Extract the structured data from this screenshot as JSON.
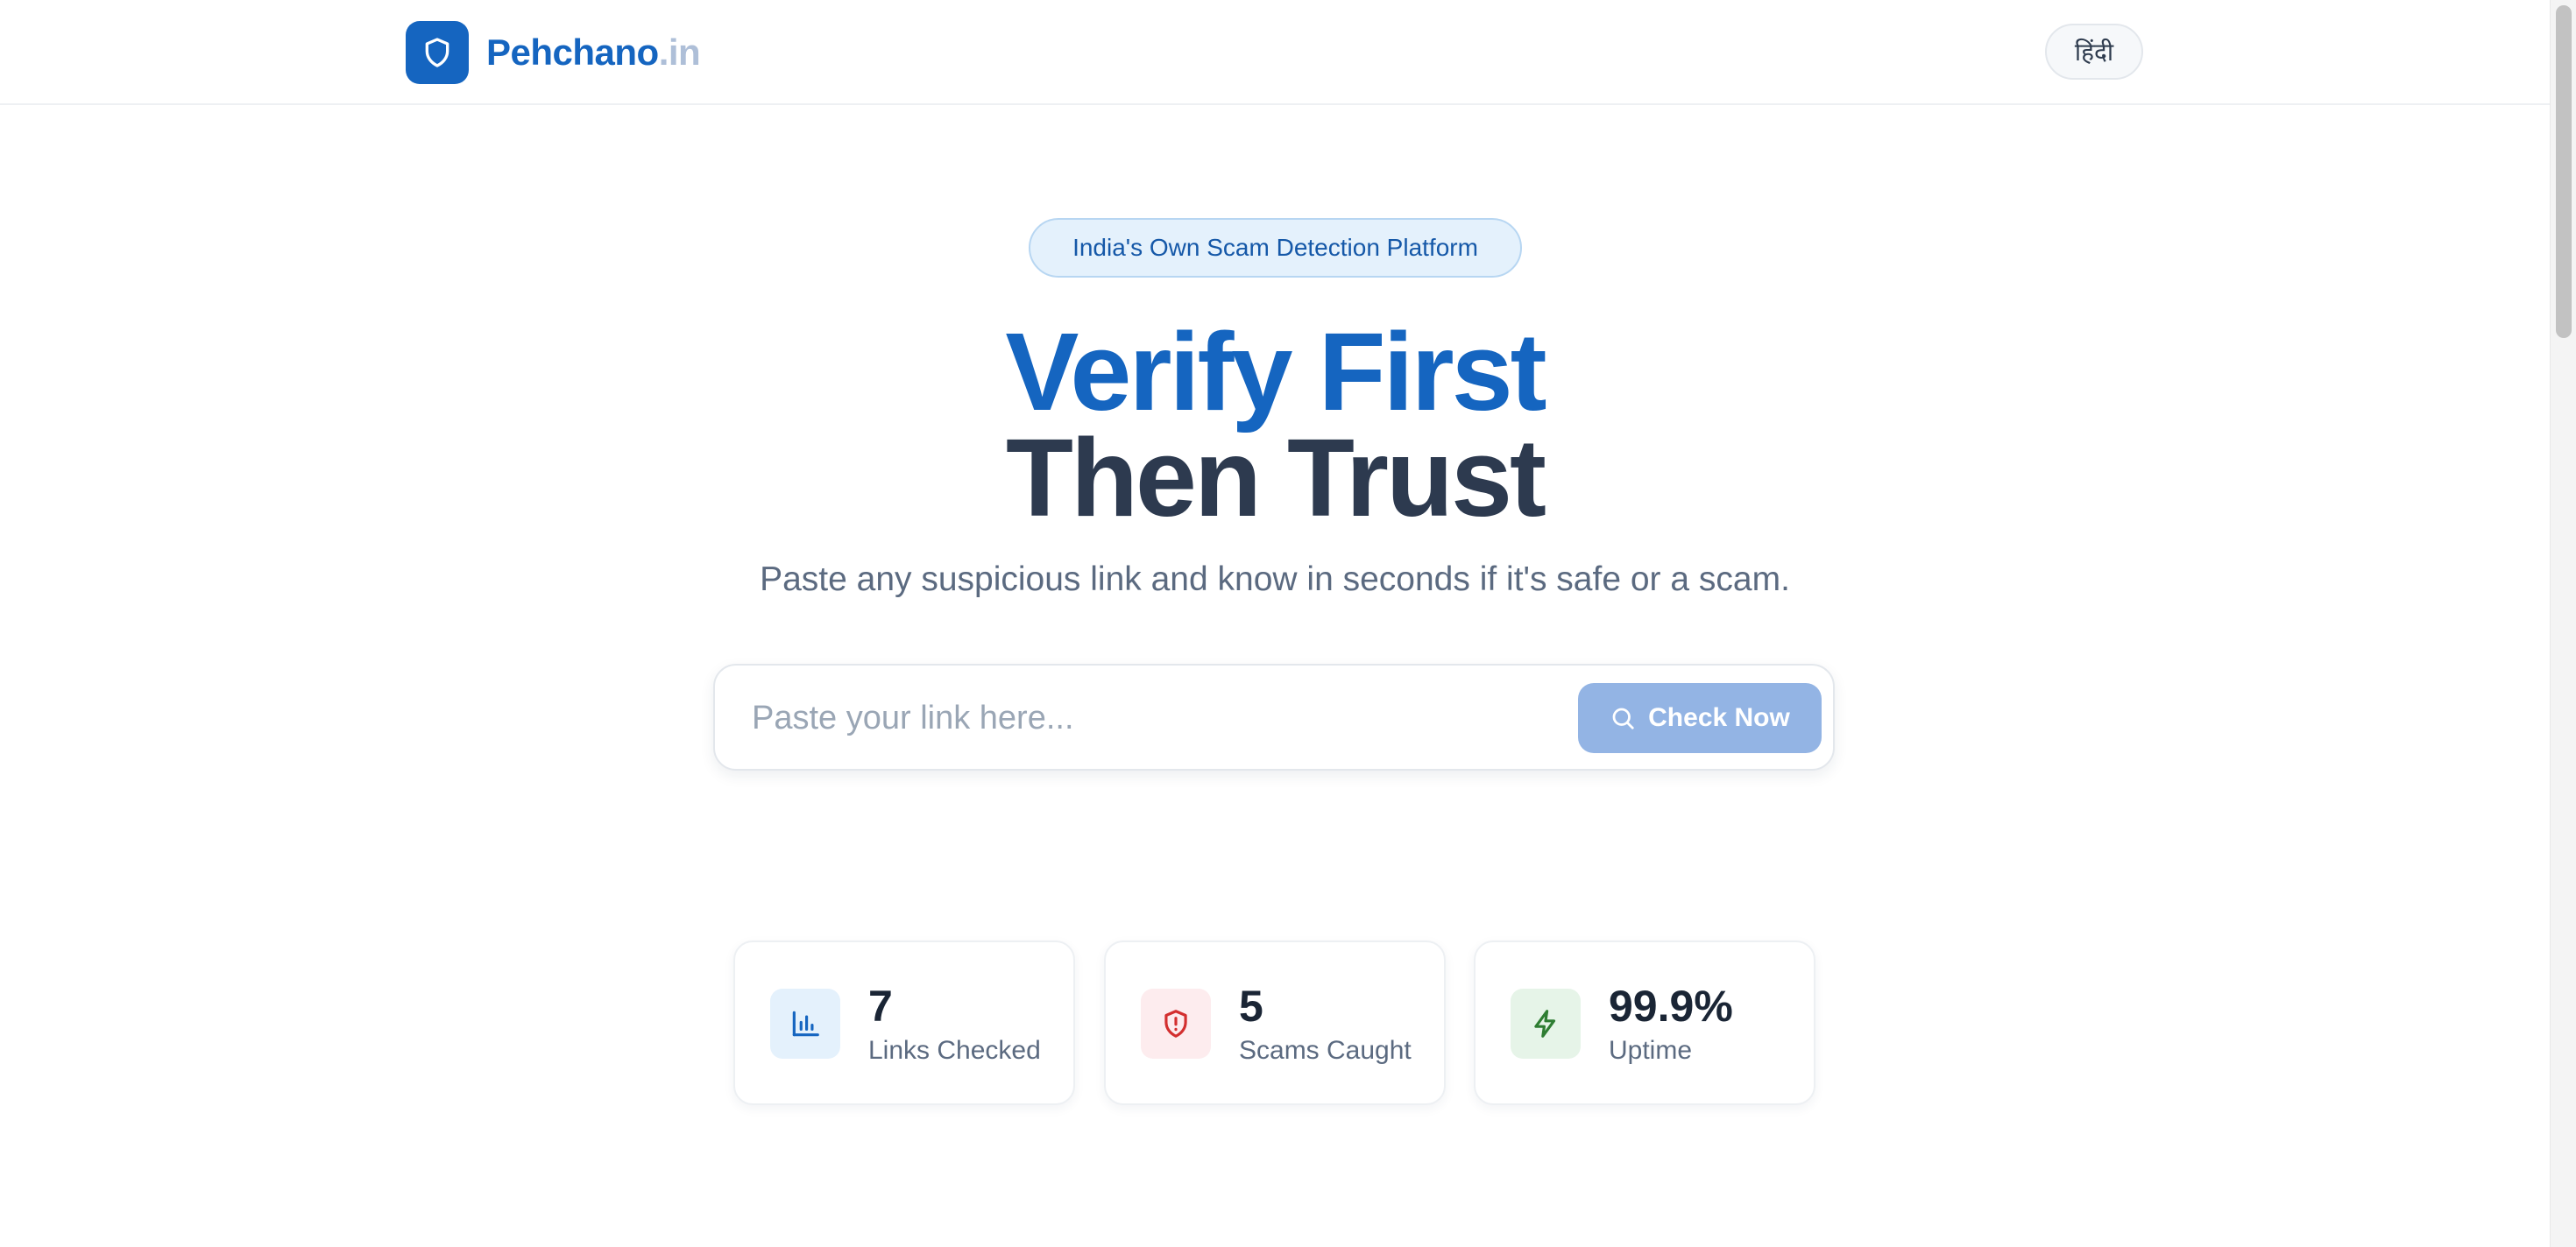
{
  "header": {
    "logo_icon": "shield-icon",
    "brand_name": "Pehchano",
    "brand_tld": ".in",
    "language_toggle": "हिंदी"
  },
  "hero": {
    "badge": "India's Own Scam Detection Platform",
    "title_line1": "Verify First",
    "title_line2": "Then Trust",
    "subtitle": "Paste any suspicious link and know in seconds if it's safe or a scam."
  },
  "search": {
    "value": "",
    "placeholder": "Paste your link here...",
    "button_label": "Check Now",
    "button_icon": "search-icon"
  },
  "stats": [
    {
      "value": "7",
      "label": "Links Checked",
      "icon": "bar-chart-icon",
      "color": "#1565c0",
      "bg": "#e4f1fc"
    },
    {
      "value": "5",
      "label": "Scams Caught",
      "icon": "shield-alert-icon",
      "color": "#d32f2f",
      "bg": "#fdecee"
    },
    {
      "value": "99.9%",
      "label": "Uptime",
      "icon": "lightning-icon",
      "color": "#2e7d32",
      "bg": "#e6f4e8"
    }
  ],
  "colors": {
    "primary": "#1565c0",
    "heading_dark": "#2d3a4f",
    "button_disabled": "#93b4e4"
  }
}
